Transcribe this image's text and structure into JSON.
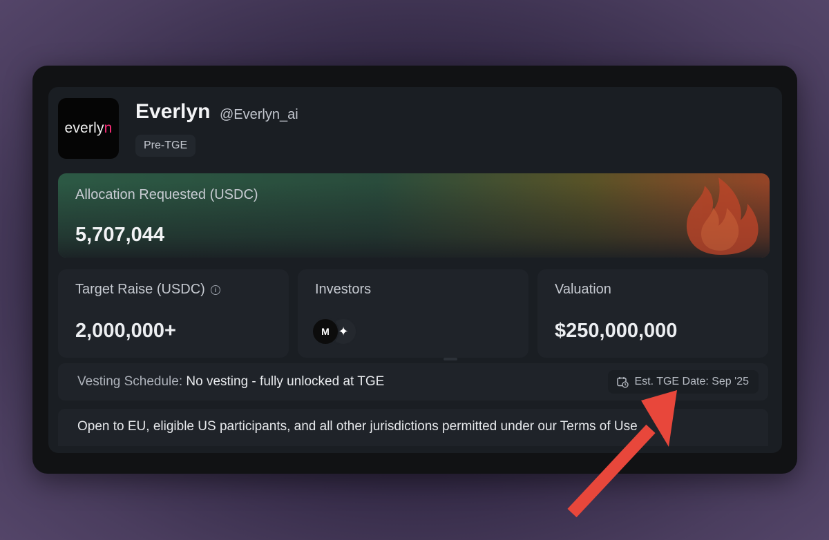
{
  "project": {
    "logo_text_main": "everly",
    "logo_text_accent": "n",
    "name": "Everlyn",
    "handle": "@Everlyn_ai",
    "badge": "Pre-TGE"
  },
  "allocation": {
    "label": "Allocation Requested (USDC)",
    "value": "5,707,044"
  },
  "stats": {
    "target_raise": {
      "label": "Target Raise (USDC)",
      "info_glyph": "i",
      "value": "2,000,000+"
    },
    "investors": {
      "label": "Investors",
      "avatar_1": "M",
      "avatar_2": "✦"
    },
    "valuation": {
      "label": "Valuation",
      "value": "$250,000,000"
    }
  },
  "vesting": {
    "prefix": "Vesting Schedule: ",
    "value": "No vesting - fully unlocked at TGE",
    "tge_date": "Est. TGE Date: Sep '25"
  },
  "jurisdictions": {
    "text": "Open to EU, eligible US participants, and all other jurisdictions permitted under our Terms of Use"
  },
  "icons": [
    "info-icon",
    "calendar-icon",
    "flame-icon"
  ],
  "colors": {
    "logo_accent": "#ff2e7a",
    "annotation_arrow": "#e8473b"
  }
}
